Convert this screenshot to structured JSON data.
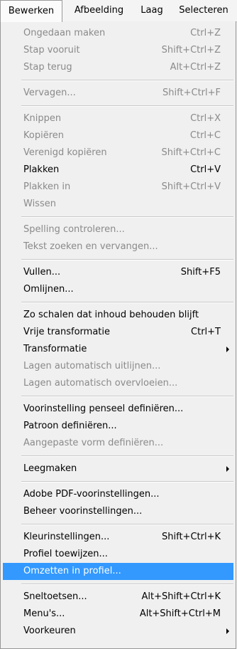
{
  "menubar": {
    "items": [
      {
        "label": "Bewerken",
        "active": true
      },
      {
        "label": "Afbeelding"
      },
      {
        "label": "Laag"
      },
      {
        "label": "Selecteren"
      }
    ]
  },
  "menu": {
    "groups": [
      [
        {
          "label": "Ongedaan maken",
          "shortcut": "Ctrl+Z",
          "disabled": true
        },
        {
          "label": "Stap vooruit",
          "shortcut": "Shift+Ctrl+Z",
          "disabled": true
        },
        {
          "label": "Stap terug",
          "shortcut": "Alt+Ctrl+Z",
          "disabled": true
        }
      ],
      [
        {
          "label": "Vervagen...",
          "shortcut": "Shift+Ctrl+F",
          "disabled": true
        }
      ],
      [
        {
          "label": "Knippen",
          "shortcut": "Ctrl+X",
          "disabled": true
        },
        {
          "label": "Kopiëren",
          "shortcut": "Ctrl+C",
          "disabled": true
        },
        {
          "label": "Verenigd kopiëren",
          "shortcut": "Shift+Ctrl+C",
          "disabled": true
        },
        {
          "label": "Plakken",
          "shortcut": "Ctrl+V",
          "disabled": false
        },
        {
          "label": "Plakken in",
          "shortcut": "Shift+Ctrl+V",
          "disabled": true
        },
        {
          "label": "Wissen",
          "shortcut": "",
          "disabled": true
        }
      ],
      [
        {
          "label": "Spelling controleren...",
          "shortcut": "",
          "disabled": true
        },
        {
          "label": "Tekst zoeken en vervangen...",
          "shortcut": "",
          "disabled": true
        }
      ],
      [
        {
          "label": "Vullen...",
          "shortcut": "Shift+F5",
          "disabled": false
        },
        {
          "label": "Omlijnen...",
          "shortcut": "",
          "disabled": false
        }
      ],
      [
        {
          "label": "Zo schalen dat inhoud behouden blijft",
          "shortcut": "",
          "disabled": false
        },
        {
          "label": "Vrije transformatie",
          "shortcut": "Ctrl+T",
          "disabled": false
        },
        {
          "label": "Transformatie",
          "shortcut": "",
          "disabled": false,
          "submenu": true
        },
        {
          "label": "Lagen automatisch uitlijnen...",
          "shortcut": "",
          "disabled": true
        },
        {
          "label": "Lagen automatisch overvloeien...",
          "shortcut": "",
          "disabled": true
        }
      ],
      [
        {
          "label": "Voorinstelling penseel definiëren...",
          "shortcut": "",
          "disabled": false
        },
        {
          "label": "Patroon definiëren...",
          "shortcut": "",
          "disabled": false
        },
        {
          "label": "Aangepaste vorm definiëren...",
          "shortcut": "",
          "disabled": true
        }
      ],
      [
        {
          "label": "Leegmaken",
          "shortcut": "",
          "disabled": false,
          "submenu": true
        }
      ],
      [
        {
          "label": "Adobe PDF-voorinstellingen...",
          "shortcut": "",
          "disabled": false
        },
        {
          "label": "Beheer voorinstellingen...",
          "shortcut": "",
          "disabled": false
        }
      ],
      [
        {
          "label": "Kleurinstellingen...",
          "shortcut": "Shift+Ctrl+K",
          "disabled": false
        },
        {
          "label": "Profiel toewijzen...",
          "shortcut": "",
          "disabled": false
        },
        {
          "label": "Omzetten in profiel...",
          "shortcut": "",
          "disabled": false,
          "highlighted": true
        }
      ],
      [
        {
          "label": "Sneltoetsen...",
          "shortcut": "Alt+Shift+Ctrl+K",
          "disabled": false
        },
        {
          "label": "Menu's...",
          "shortcut": "Alt+Shift+Ctrl+M",
          "disabled": false
        },
        {
          "label": "Voorkeuren",
          "shortcut": "",
          "disabled": false,
          "submenu": true
        }
      ]
    ]
  },
  "colors": {
    "highlight": "#3399ff",
    "disabled_text": "#8a8a8a",
    "menu_bg": "#f0f0f0"
  }
}
